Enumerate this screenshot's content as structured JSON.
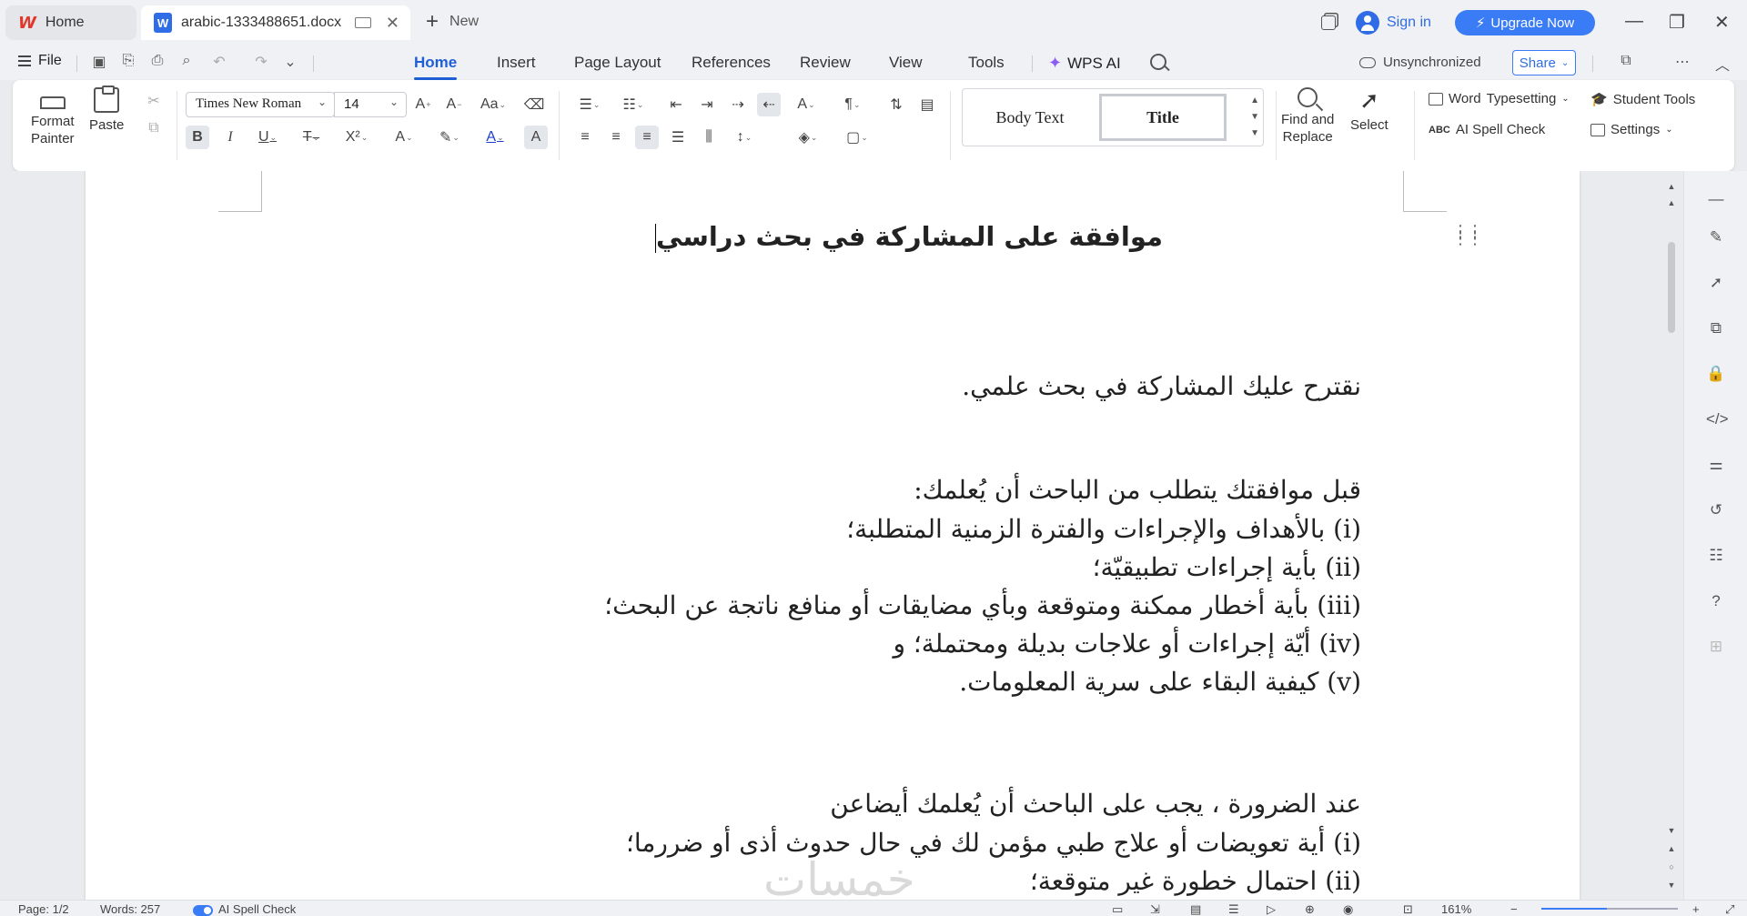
{
  "tabs": {
    "home_label": "Home",
    "doc_label": "arabic-1333488651.docx",
    "new_label": "New"
  },
  "account": {
    "signin": "Sign in",
    "upgrade": "Upgrade Now"
  },
  "menu": {
    "file": "File",
    "items": [
      "Home",
      "Insert",
      "Page Layout",
      "References",
      "Review",
      "View",
      "Tools"
    ],
    "active": "Home",
    "wps_ai": "WPS AI",
    "sync_status": "Unsynchronized",
    "share": "Share"
  },
  "ribbon": {
    "format_painter": [
      "Format",
      "Painter"
    ],
    "paste": "Paste",
    "font_name": "Times New Roman",
    "font_size": "14",
    "styles": {
      "body_text": "Body Text",
      "title": "Title"
    },
    "find_replace": [
      "Find and",
      "Replace"
    ],
    "select": "Select",
    "word_typesetting": [
      "Word",
      "Typesetting"
    ],
    "student_tools": "Student Tools",
    "ai_spell_check": "AI Spell Check",
    "settings": "Settings"
  },
  "document": {
    "title": "موافقة على المشاركة في بحث دراسي",
    "paragraphs": [
      "نقترح عليك المشاركة في بحث علمي.",
      "قبل موافقتك يتطلب من الباحث أن يُعلمك:",
      "(i) بالأهداف والإجراءات والفترة الزمنية المتطلبة؛",
      "(ii) بأية إجراءات تطبيقيّة؛",
      "(iii) بأية أخطار ممكنة ومتوقعة وبأي مضايقات أو منافع ناتجة عن البحث؛",
      "(iv) أيّة إجراءات أو علاجات بديلة ومحتملة؛ و",
      "(v) كيفية البقاء على سرية المعلومات.",
      "عند الضرورة ، يجب على الباحث أن يُعلمك أيضاعن",
      "(i) أية تعويضات أو علاج طبي مؤمن لك في حال حدوث أذى أو ضررما؛",
      "(ii) احتمال خطورة غير متوقعة؛"
    ],
    "watermark": "خمسات"
  },
  "status": {
    "page": "Page: 1/2",
    "words": "Words: 257",
    "spell_check": "AI Spell Check",
    "zoom": "161%",
    "zoom_level": 0.48
  },
  "colors": {
    "accent": "#1f5fd6",
    "upgrade": "#3a7bf6",
    "wps_red": "#e2382c"
  }
}
